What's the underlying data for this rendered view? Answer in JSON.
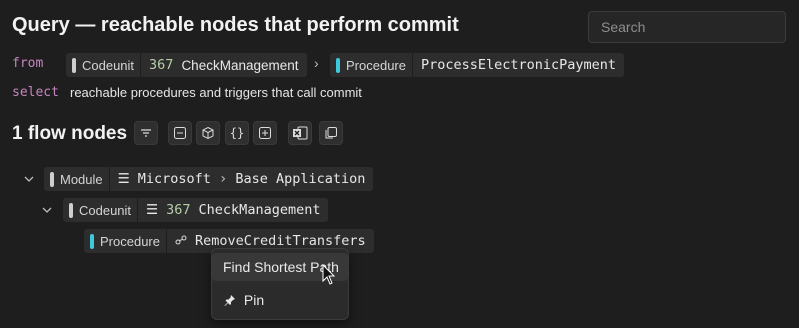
{
  "header": {
    "title": "Query — reachable nodes that perform commit",
    "search_placeholder": "Search"
  },
  "query": {
    "from_kw": "from",
    "select_kw": "select",
    "from_source": {
      "kind": "Codeunit",
      "number": "367",
      "name": "CheckManagement"
    },
    "from_target": {
      "kind": "Procedure",
      "name": "ProcessElectronicPayment"
    },
    "select_text": "reachable procedures and triggers that call commit"
  },
  "results": {
    "count_label": "1 flow nodes",
    "toolbar_icons": [
      "filter-icon",
      "collapse-all-icon",
      "package-icon",
      "json-icon",
      "expand-all-icon",
      "excel-icon",
      "copy-icon"
    ]
  },
  "tree": {
    "module": {
      "kind": "Module",
      "publisher": "Microsoft",
      "name": "Base Application"
    },
    "codeunit": {
      "kind": "Codeunit",
      "number": "367",
      "name": "CheckManagement"
    },
    "procedure": {
      "kind": "Procedure",
      "name": "RemoveCreditTransfers"
    }
  },
  "context_menu": {
    "items": [
      {
        "label": "Find Shortest Path",
        "icon": ""
      },
      {
        "label": "Pin",
        "icon": "pin-icon"
      }
    ]
  },
  "colors": {
    "keyword": "#c586c0",
    "number": "#b5cea8",
    "procedure_bar": "#3ec8dc",
    "background": "#1e1e1e"
  }
}
